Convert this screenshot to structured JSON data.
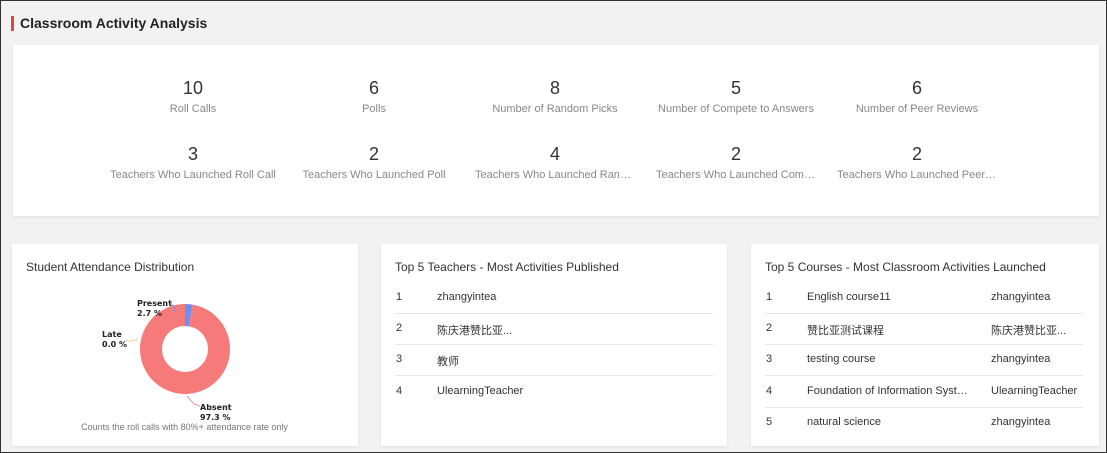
{
  "header": {
    "title": "Classroom Activity Analysis"
  },
  "stats_row1": [
    {
      "value": "10",
      "label": "Roll Calls"
    },
    {
      "value": "6",
      "label": "Polls"
    },
    {
      "value": "8",
      "label": "Number of Random Picks"
    },
    {
      "value": "5",
      "label": "Number of Compete to Answers"
    },
    {
      "value": "6",
      "label": "Number of Peer Reviews"
    }
  ],
  "stats_row2": [
    {
      "value": "3",
      "label": "Teachers Who Launched Roll Call"
    },
    {
      "value": "2",
      "label": "Teachers Who Launched Poll"
    },
    {
      "value": "4",
      "label": "Teachers Who Launched Random Pick"
    },
    {
      "value": "2",
      "label": "Teachers Who Launched Compete to Answer"
    },
    {
      "value": "2",
      "label": "Teachers Who Launched Peer Review"
    }
  ],
  "attendance": {
    "title": "Student Attendance Distribution",
    "footnote": "Counts the roll calls with 80%+ attendance rate only",
    "slices": [
      {
        "name": "Present",
        "percent_label": "2.7 %",
        "value": 2.7,
        "color": "#6f8ff0"
      },
      {
        "name": "Late",
        "percent_label": "0.0 %",
        "value": 0.0,
        "color": "#f6c36a"
      },
      {
        "name": "Absent",
        "percent_label": "97.3 %",
        "value": 97.3,
        "color": "#f77a7a"
      }
    ]
  },
  "top_teachers": {
    "title": "Top 5 Teachers - Most Activities Published",
    "rows": [
      {
        "rank": "1",
        "name": "zhangyintea"
      },
      {
        "rank": "2",
        "name": "陈庆港赞比亚..."
      },
      {
        "rank": "3",
        "name": "教师"
      },
      {
        "rank": "4",
        "name": "UlearningTeacher"
      }
    ]
  },
  "top_courses": {
    "title": "Top 5 Courses - Most Classroom Activities Launched",
    "rows": [
      {
        "rank": "1",
        "course": "English course11",
        "teacher": "zhangyintea"
      },
      {
        "rank": "2",
        "course": "赞比亚测试课程",
        "teacher": "陈庆港赞比亚..."
      },
      {
        "rank": "3",
        "course": "testing course",
        "teacher": "zhangyintea"
      },
      {
        "rank": "4",
        "course": "Foundation of Information Systems",
        "teacher": "UlearningTeacher"
      },
      {
        "rank": "5",
        "course": "natural science",
        "teacher": "zhangyintea"
      }
    ]
  }
}
